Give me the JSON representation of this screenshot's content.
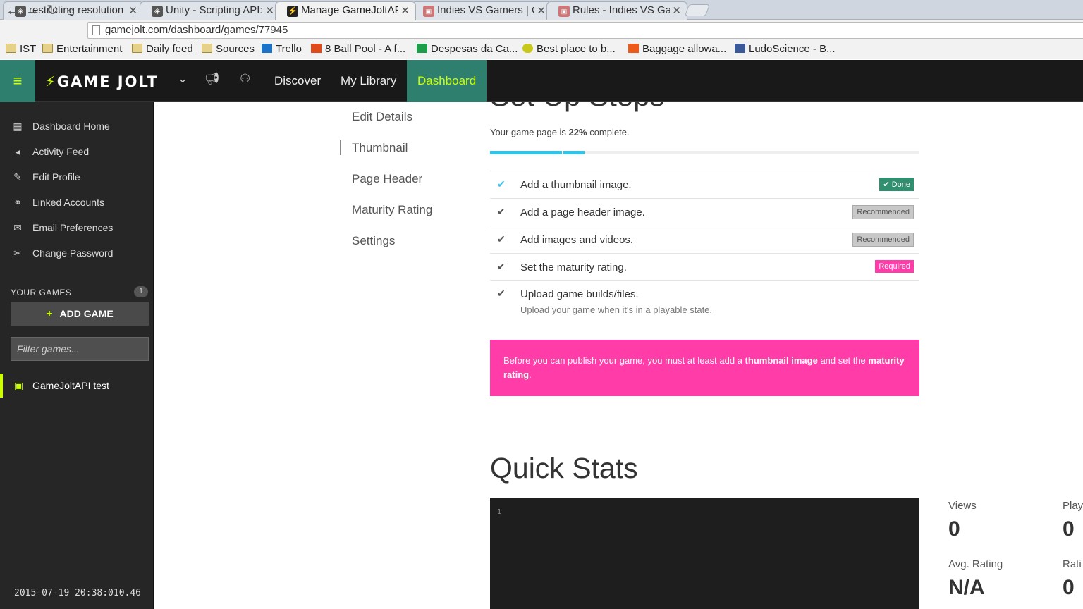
{
  "browser": {
    "tabs": [
      {
        "title": "restricting resolution",
        "icon": "unity-icon"
      },
      {
        "title": "Unity - Scripting API:",
        "icon": "unity-icon"
      },
      {
        "title": "Manage GameJoltAPI",
        "icon": "gamejolt-icon"
      },
      {
        "title": "Indies VS Gamers | G",
        "icon": "site-icon"
      },
      {
        "title": "Rules - Indies VS Gam",
        "icon": "site-icon"
      }
    ],
    "url": "gamejolt.com/dashboard/games/77945",
    "bookmarks": [
      "IST",
      "Entertainment",
      "Daily feed",
      "Sources",
      "Trello",
      "8 Ball Pool - A f...",
      "Despesas da Ca...",
      "Best place to b...",
      "Baggage allowa...",
      "LudoScience - B..."
    ]
  },
  "header": {
    "logo": "GAME JOLT",
    "nav": [
      "Discover",
      "My Library",
      "Dashboard"
    ],
    "accent": "#ccff00",
    "brand": "#2f7f6f"
  },
  "sidebar": {
    "items": [
      {
        "label": "Dashboard Home",
        "icon": "dashboard-icon"
      },
      {
        "label": "Activity Feed",
        "icon": "megaphone-icon"
      },
      {
        "label": "Edit Profile",
        "icon": "pencil-icon"
      },
      {
        "label": "Linked Accounts",
        "icon": "link-icon"
      },
      {
        "label": "Email Preferences",
        "icon": "envelope-icon"
      },
      {
        "label": "Change Password",
        "icon": "wrench-icon"
      }
    ],
    "your_games_label": "YOUR GAMES",
    "games_count": "1",
    "add_game_label": "ADD GAME",
    "filter_placeholder": "Filter games...",
    "game_name": "GameJoltAPI test",
    "timestamp": "2015-07-19 20:38:010.46"
  },
  "subnav": [
    "Edit Details",
    "Thumbnail",
    "Page Header",
    "Maturity Rating",
    "Settings"
  ],
  "setup": {
    "title": "Set Up Steps",
    "progress_prefix": "Your game page is ",
    "progress_value": "22%",
    "progress_suffix": " complete.",
    "progress_fraction": 0.22,
    "steps": [
      {
        "label": "Add a thumbnail image.",
        "badge": "Done",
        "done": true
      },
      {
        "label": "Add a page header image.",
        "badge": "Recommended"
      },
      {
        "label": "Add images and videos.",
        "badge": "Recommended"
      },
      {
        "label": "Set the maturity rating.",
        "badge": "Required"
      },
      {
        "label": "Upload game builds/files.",
        "sub": "Upload your game when it's in a playable state."
      }
    ],
    "alert": {
      "t1": "Before you can publish your game, you must at least add a ",
      "b1": "thumbnail image",
      "t2": " and set the ",
      "b2": "maturity rating",
      "t3": "."
    }
  },
  "stats": {
    "title": "Quick Stats",
    "editor_line": "1",
    "views_label": "Views",
    "views_value": "0",
    "plays_label": "Play",
    "plays_value": "0",
    "avg_label": "Avg. Rating",
    "avg_value": "N/A",
    "ratings_label": "Rati",
    "ratings_value": "0"
  }
}
